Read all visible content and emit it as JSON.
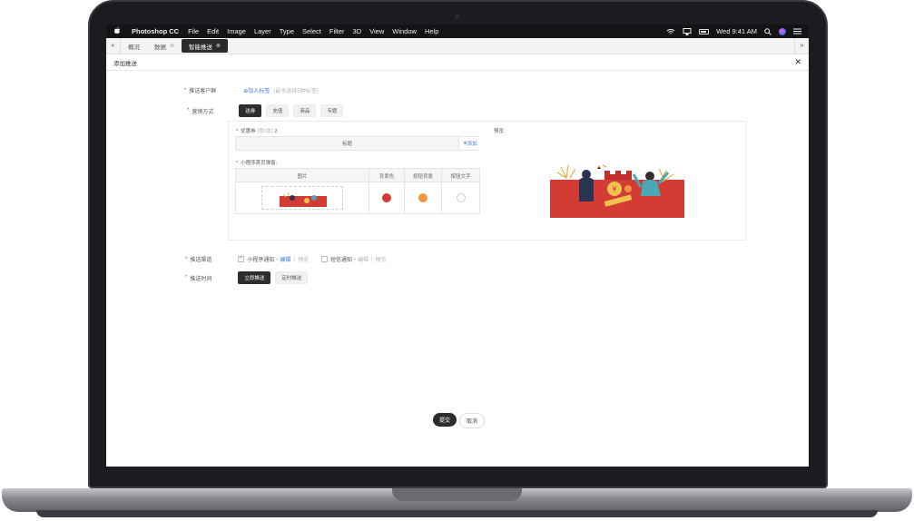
{
  "menubar": {
    "apple": "",
    "app_name": "Photoshop CC",
    "items": [
      "File",
      "Edit",
      "Image",
      "Layer",
      "Type",
      "Select",
      "Filter",
      "3D",
      "View",
      "Window",
      "Help"
    ],
    "clock": "Wed 9:41 AM"
  },
  "tabs": [
    {
      "label": "概况"
    },
    {
      "label": "数据"
    },
    {
      "label": "智能推送"
    }
  ],
  "subheader": {
    "title": "添加推送"
  },
  "form": {
    "audience": {
      "label": "推送客户群",
      "link": "加入标签",
      "hint": "(最多选择5种标签)"
    },
    "method": {
      "label": "营销方式",
      "options": [
        "送券",
        "充值",
        "商品",
        "专题"
      ]
    },
    "coupon": {
      "label": "优惠券",
      "hint": "(限3张)",
      "count": "2",
      "col_title": "标题",
      "add": "添加"
    },
    "popup": {
      "label": "小程序首页弹窗:",
      "cols": [
        "图片",
        "背景色",
        "按钮背景",
        "按钮文字"
      ]
    },
    "preview": {
      "label": "预览:"
    },
    "channel": {
      "label": "推送渠道",
      "items": [
        {
          "label": "小程序通知",
          "edit": "编辑",
          "sep": "|",
          "preview": "预览",
          "checked": true
        },
        {
          "label": "短信通知",
          "edit": "编辑",
          "sep": "|",
          "preview": "预览",
          "checked": false
        }
      ]
    },
    "time": {
      "label": "推送时间",
      "options": [
        "立即推送",
        "定时推送"
      ]
    },
    "submit": "提交",
    "cancel": "取消"
  },
  "colors": {
    "bg_color": "#d33b35",
    "button_bg": "#f2953c",
    "button_text": "#ffffff",
    "accent": "#3d7be0"
  }
}
